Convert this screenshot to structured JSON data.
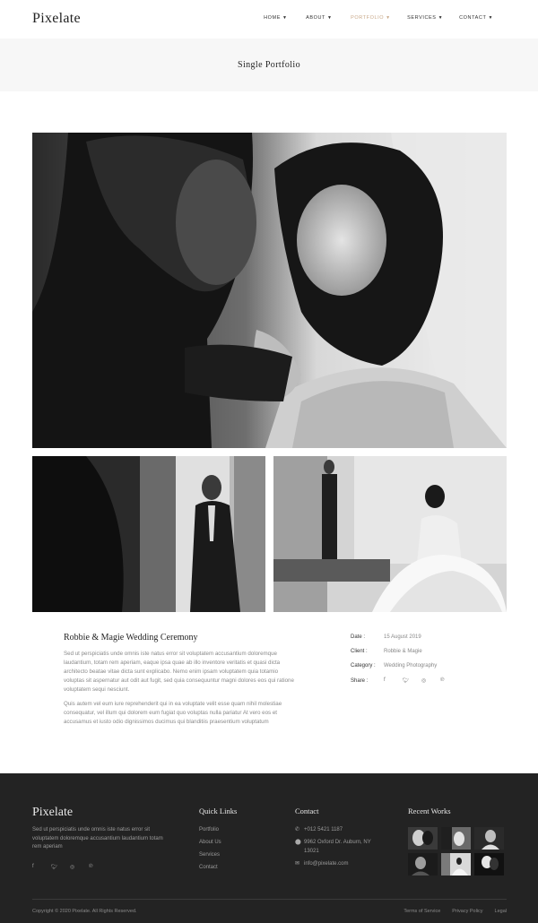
{
  "brand": "Pixelate",
  "nav": [
    {
      "label": "HOME",
      "active": false
    },
    {
      "label": "ABOUT",
      "active": false
    },
    {
      "label": "PORTFOLIO",
      "active": true
    },
    {
      "label": "SERVICES",
      "active": false
    },
    {
      "label": "CONTACT",
      "active": false
    }
  ],
  "page_title": "Single Portfolio",
  "project": {
    "title": "Robbie & Magie Wedding Ceremony",
    "paragraph1": "Sed ut perspiciatis unde omnis iste natus error sit voluptatem accusantium doloremque laudantium, totam rem aperiam, eaque ipsa quae ab illo inventore veritatis et quasi dicta architecto beatae vitae dicta sunt explicabo. Nemo enim ipsam voluptatem quia totamio voluptas sit aspernatur aut odit aut fugit, sed quia consequuntur magni dolores eos qui ratione voluptatem sequi nesciunt.",
    "paragraph2": "Quis autem vel eum iure reprehenderit qui in ea voluptate velit esse quam nihil molestiae consequatur, vel illum qui dolorem eum fugiat quo voluptas nulla pariatur At vero eos et accusamus et iusto odio dignissimos ducimus qui blanditiis praesentium voluptatum",
    "meta": {
      "date_label": "Date :",
      "date_value": "15 August 2019",
      "client_label": "Client :",
      "client_value": "Robbie & Magie",
      "category_label": "Category :",
      "category_value": "Wedding Photography",
      "share_label": "Share :"
    },
    "share_icons": [
      "facebook-icon",
      "twitter-icon",
      "instagram-icon",
      "pinterest-icon"
    ]
  },
  "footer": {
    "brand": "Pixelate",
    "description": "Sed ut perspiciatis unde omnis iste natus error sit voluptatem doloremque accusantium laudantium totam rem aperiam",
    "quick_links_heading": "Quick Links",
    "quick_links": [
      "Portfolio",
      "About Us",
      "Services",
      "Contact"
    ],
    "contact_heading": "Contact",
    "phone": "+012 5421 1187",
    "address_line1": "9962 Oxford Dr. Auburn, NY",
    "address_line2": "13021",
    "email": "info@pixelate.com",
    "recent_works_heading": "Recent Works",
    "copyright": "Copyright © 2020 Pixelate. All Rights Reserved.",
    "legal_links": [
      "Terms of Service",
      "Privacy Policy",
      "Legal"
    ]
  }
}
